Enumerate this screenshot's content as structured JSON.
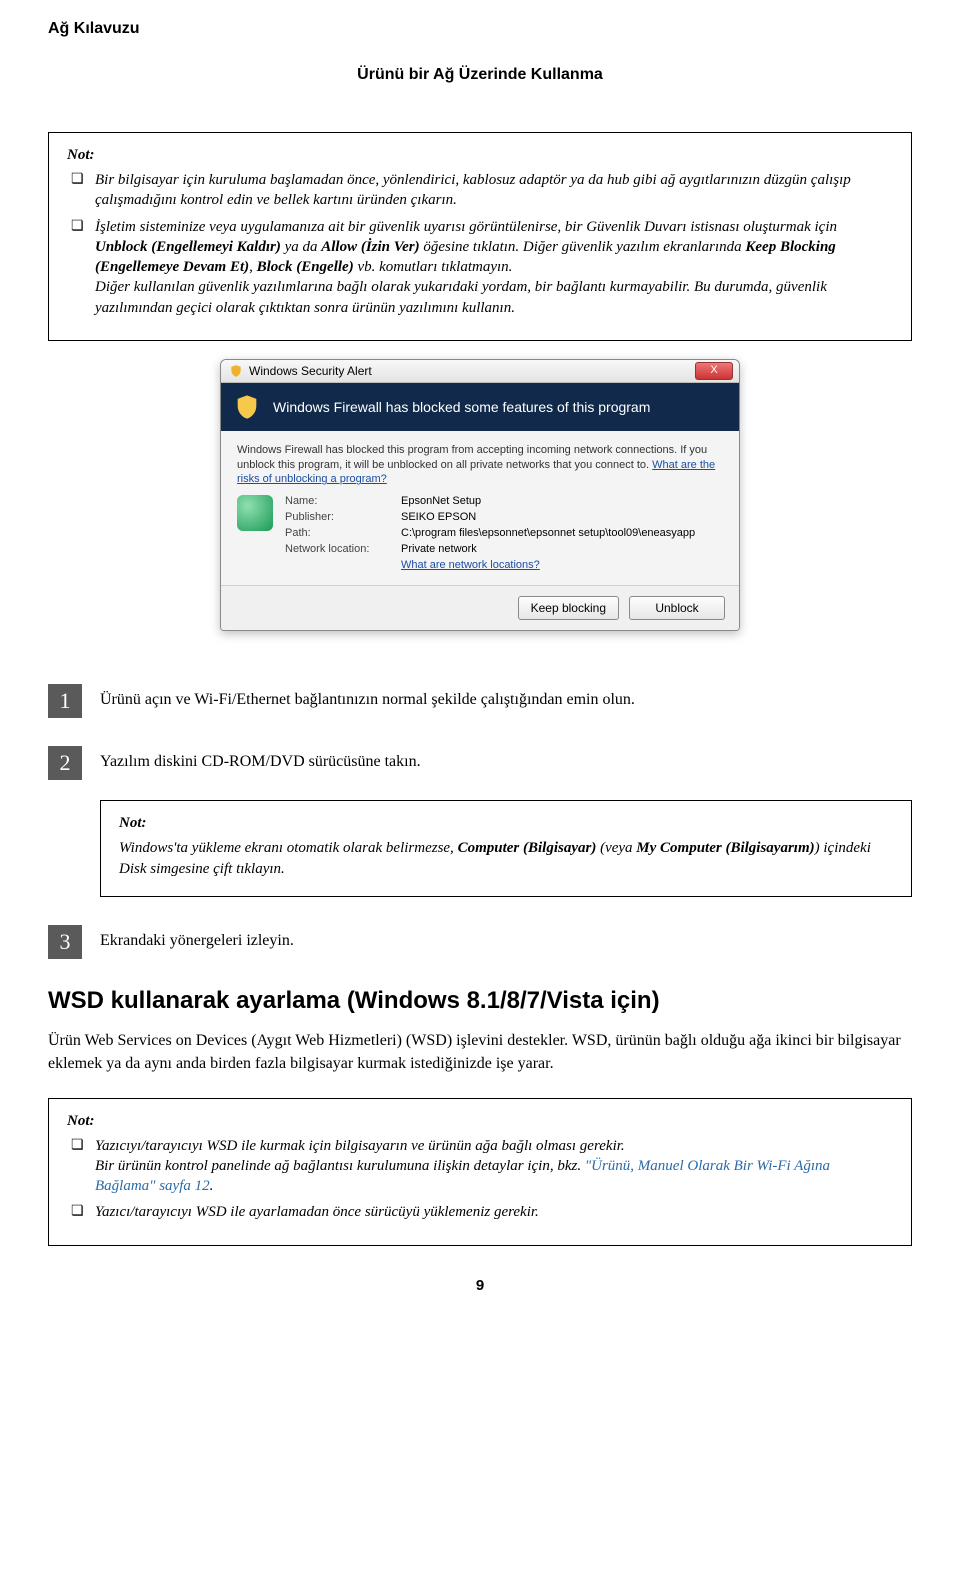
{
  "doc_title": "Ağ Kılavuzu",
  "chapter_title": "Ürünü bir Ağ Üzerinde Kullanma",
  "note1": {
    "label": "Not:",
    "items": [
      {
        "text": "Bir bilgisayar için kuruluma başlamadan önce, yönlendirici, kablosuz adaptör ya da hub gibi ağ aygıtlarınızın düzgün çalışıp çalışmadığını kontrol edin ve bellek kartını üründen çıkarın."
      },
      {
        "text": "İşletim sisteminize veya uygulamanıza ait bir güvenlik uyarısı görüntülenirse, bir Güvenlik Duvarı istisnası oluşturmak için <b>Unblock (Engellemeyi Kaldır)</b> ya da <b>Allow (İzin Ver)</b> öğesine tıklatın. Diğer güvenlik yazılım ekranlarında <b>Keep Blocking (Engellemeye Devam Et)</b>, <b>Block (Engelle)</b> vb. komutları tıklatmayın.\nDiğer kullanılan güvenlik yazılımlarına bağlı olarak yukarıdaki yordam, bir bağlantı kurmayabilir. Bu durumda, güvenlik yazılımından geçici olarak çıktıktan sonra ürünün yazılımını kullanın."
      }
    ]
  },
  "dialog": {
    "title": "Windows Security Alert",
    "banner": "Windows Firewall has blocked some features of this program",
    "info_text_1": "Windows Firewall has blocked this program from accepting incoming network connections. If you unblock this program, it will be unblocked on all private networks that you connect to. ",
    "info_link": "What are the risks of unblocking a program?",
    "name_k": "Name:",
    "name_v": "EpsonNet Setup",
    "pub_k": "Publisher:",
    "pub_v": "SEIKO EPSON",
    "path_k": "Path:",
    "path_v": "C:\\program files\\epsonnet\\epsonnet setup\\tool09\\eneasyapp",
    "net_k": "Network location:",
    "net_v": "Private network",
    "net_link": "What are network locations?",
    "btn_keep": "Keep blocking",
    "btn_unblock": "Unblock",
    "close": "X"
  },
  "step1": {
    "num": "1",
    "text": "Ürünü açın ve Wi-Fi/Ethernet bağlantınızın normal şekilde çalıştığından emin olun."
  },
  "step2": {
    "num": "2",
    "text": "Yazılım diskini CD-ROM/DVD sürücüsüne takın."
  },
  "step2_note": {
    "label": "Not:",
    "text": "Windows'ta yükleme ekranı otomatik olarak belirmezse, <b>Computer (Bilgisayar)</b> (veya <b>My Computer (Bilgisayarım)</b>) içindeki Disk simgesine çift tıklayın."
  },
  "step3": {
    "num": "3",
    "text": "Ekrandaki yönergeleri izleyin."
  },
  "section_heading": "WSD kullanarak ayarlama (Windows 8.1/8/7/Vista için)",
  "section_body": "Ürün Web Services on Devices (Aygıt Web Hizmetleri) (WSD) işlevini destekler. WSD, ürünün bağlı olduğu ağa ikinci bir bilgisayar eklemek ya da aynı anda birden fazla bilgisayar kurmak istediğinizde işe yarar.",
  "note2": {
    "label": "Not:",
    "items": [
      {
        "text": "Yazıcıyı/tarayıcıyı WSD ile kurmak için bilgisayarın ve ürünün ağa bağlı olması gerekir.\nBir ürünün kontrol panelinde ağ bağlantısı kurulumuna ilişkin detaylar için, bkz. ",
        "link": "\"Ürünü, Manuel Olarak Bir Wi-Fi Ağına Bağlama\" sayfa 12",
        "tail": "."
      },
      {
        "text": "Yazıcı/tarayıcıyı WSD ile ayarlamadan önce sürücüyü yüklemeniz gerekir."
      }
    ]
  },
  "page_number": "9"
}
